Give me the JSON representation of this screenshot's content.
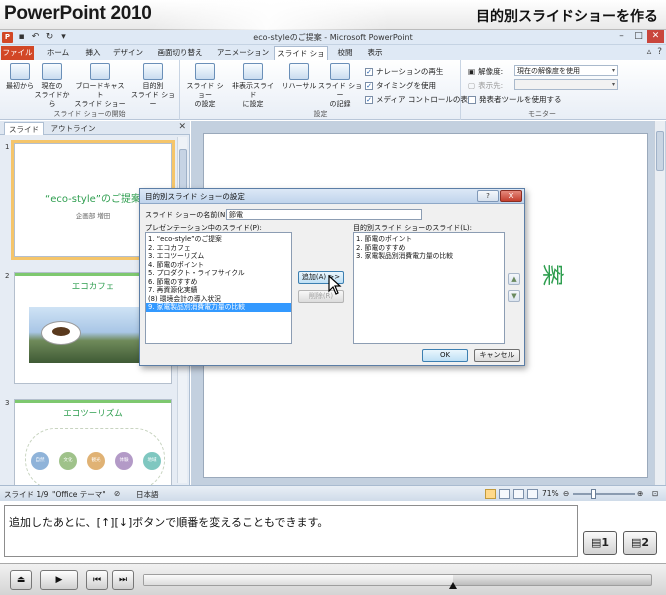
{
  "tutorial": {
    "brand": "PowerPoint 2010",
    "title": "目的別スライドショーを作る"
  },
  "window": {
    "title": "eco-styleのご提案 - Microsoft PowerPoint",
    "app_icon": "P"
  },
  "ribbon_tabs": [
    {
      "label": "ファイル"
    },
    {
      "label": "ホーム"
    },
    {
      "label": "挿入"
    },
    {
      "label": "デザイン"
    },
    {
      "label": "画面切り替え"
    },
    {
      "label": "アニメーション"
    },
    {
      "label": "スライド ショー"
    },
    {
      "label": "校閲"
    },
    {
      "label": "表示"
    }
  ],
  "ribbon": {
    "group1": {
      "label": "スライド ショーの開始",
      "buttons": [
        {
          "label": "最初から"
        },
        {
          "label": "現在の\nスライドから"
        },
        {
          "label": "ブロードキャスト\nスライド ショー"
        },
        {
          "label": "目的別\nスライド ショー"
        }
      ]
    },
    "group2": {
      "label": "設定",
      "buttons": [
        {
          "label": "スライド ショー\nの設定"
        },
        {
          "label": "非表示スライド\nに設定"
        },
        {
          "label": "リハーサル"
        },
        {
          "label": "スライド ショー\nの記録"
        }
      ],
      "checks": [
        {
          "label": "ナレーションの再生",
          "checked": true
        },
        {
          "label": "タイミングを使用",
          "checked": true
        },
        {
          "label": "メディア コントロールの表示",
          "checked": true
        }
      ]
    },
    "group3": {
      "label": "モニター",
      "resolution_label": "解像度:",
      "resolution_value": "現在の解像度を使用",
      "display_label": "表示先:",
      "presenter_label": "発表者ツールを使用する"
    }
  },
  "left_pane": {
    "tabs": [
      {
        "label": "スライド"
      },
      {
        "label": "アウトライン"
      }
    ],
    "slides": [
      {
        "num": "1",
        "title": "“eco-style”のご提案",
        "sub": "企画部 増田"
      },
      {
        "num": "2",
        "title": "エコカフェ"
      },
      {
        "num": "3",
        "title": "エコツーリズム",
        "bubbles": [
          "自然",
          "文化",
          "観光",
          "体験",
          "地域"
        ]
      }
    ]
  },
  "main_slide": {
    "partial_text": "案"
  },
  "dialog": {
    "title": "目的別スライド ショーの設定",
    "name_label": "スライド ショーの名前(N):",
    "name_value": "節電",
    "left_list_label": "プレゼンテーション中のスライド(P):",
    "right_list_label": "目的別スライド ショーのスライド(L):",
    "left_items": [
      "1. “eco-style”のご提案",
      "2. エコカフェ",
      "3. エコツーリズム",
      "4. 節電のポイント",
      "5. プロダクト・ライフサイクル",
      "6. 節電のすすめ",
      "7. 再資源化実績",
      "(8) 環境会計の導入状況",
      "9. 家電製品別消費電力量の比較"
    ],
    "right_items": [
      "1. 節電のポイント",
      "2. 節電のすすめ",
      "3. 家電製品別消費電力量の比較"
    ],
    "add_button": "追加(A) >>",
    "remove_button": "削除(R)",
    "help_button": "?",
    "close_button": "X",
    "ok_button": "OK",
    "cancel_button": "キャンセル"
  },
  "statusbar": {
    "slide_info": "スライド 1/9",
    "theme": "\"Office テーマ\"",
    "language": "日本語",
    "zoom": "71%"
  },
  "caption": {
    "text": "追加したあとに、[↑][↓]ボタンで順番を変えることもできます。"
  },
  "player": {
    "progress": 0.61
  },
  "colors": {
    "file_tab": "#d24726",
    "accent_green": "#2e9e4f",
    "selected_thumb": "#f5c56a",
    "list_selection": "#3399ff"
  }
}
